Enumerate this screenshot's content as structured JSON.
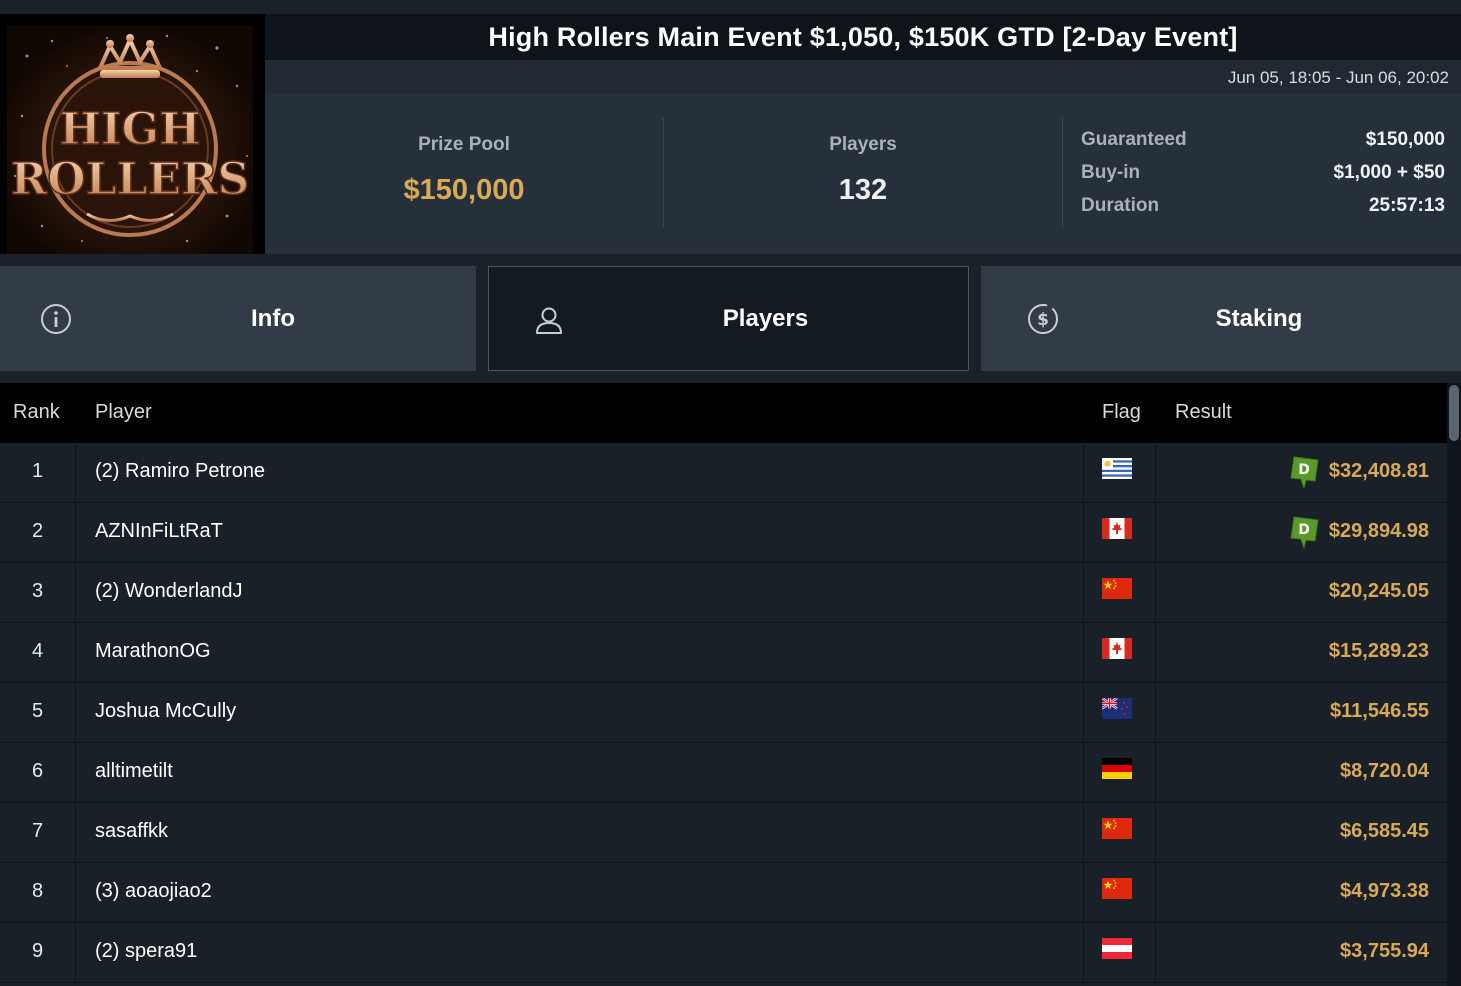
{
  "event": {
    "title": "High Rollers Main Event $1,050, $150K GTD [2-Day Event]",
    "date_range": "Jun 05, 18:05 - Jun 06, 20:02",
    "logo_text_line1": "HIGH",
    "logo_text_line2": "ROLLERS"
  },
  "stats": {
    "prize_pool_label": "Prize Pool",
    "prize_pool_value": "$150,000",
    "players_label": "Players",
    "players_value": "132",
    "details": [
      {
        "label": "Guaranteed",
        "value": "$150,000"
      },
      {
        "label": "Buy-in",
        "value": "$1,000 + $50"
      },
      {
        "label": "Duration",
        "value": "25:57:13"
      }
    ]
  },
  "tabs": [
    {
      "label": "Info",
      "icon": "info-icon",
      "active": false
    },
    {
      "label": "Players",
      "icon": "user-icon",
      "active": true
    },
    {
      "label": "Staking",
      "icon": "dollar-icon",
      "active": false
    }
  ],
  "table": {
    "headers": {
      "rank": "Rank",
      "player": "Player",
      "flag": "Flag",
      "result": "Result"
    },
    "rows": [
      {
        "rank": "1",
        "player": "(2) Ramiro Petrone",
        "flag": "uruguay",
        "result": "$32,408.81",
        "badge": "D"
      },
      {
        "rank": "2",
        "player": "AZNInFiLtRaT",
        "flag": "canada",
        "result": "$29,894.98",
        "badge": "D"
      },
      {
        "rank": "3",
        "player": "(2) WonderlandJ",
        "flag": "china",
        "result": "$20,245.05",
        "badge": ""
      },
      {
        "rank": "4",
        "player": "MarathonOG",
        "flag": "canada",
        "result": "$15,289.23",
        "badge": ""
      },
      {
        "rank": "5",
        "player": "Joshua McCully",
        "flag": "new-zealand",
        "result": "$11,546.55",
        "badge": ""
      },
      {
        "rank": "6",
        "player": "alltimetilt",
        "flag": "germany",
        "result": "$8,720.04",
        "badge": ""
      },
      {
        "rank": "7",
        "player": "sasaffkk",
        "flag": "china",
        "result": "$6,585.45",
        "badge": ""
      },
      {
        "rank": "8",
        "player": "(3) aoaojiao2",
        "flag": "china",
        "result": "$4,973.38",
        "badge": ""
      },
      {
        "rank": "9",
        "player": "(2) spera91",
        "flag": "austria",
        "result": "$3,755.94",
        "badge": ""
      }
    ]
  },
  "colors": {
    "accent_gold": "#d9aa55",
    "badge_green": "#5a9a2a"
  }
}
